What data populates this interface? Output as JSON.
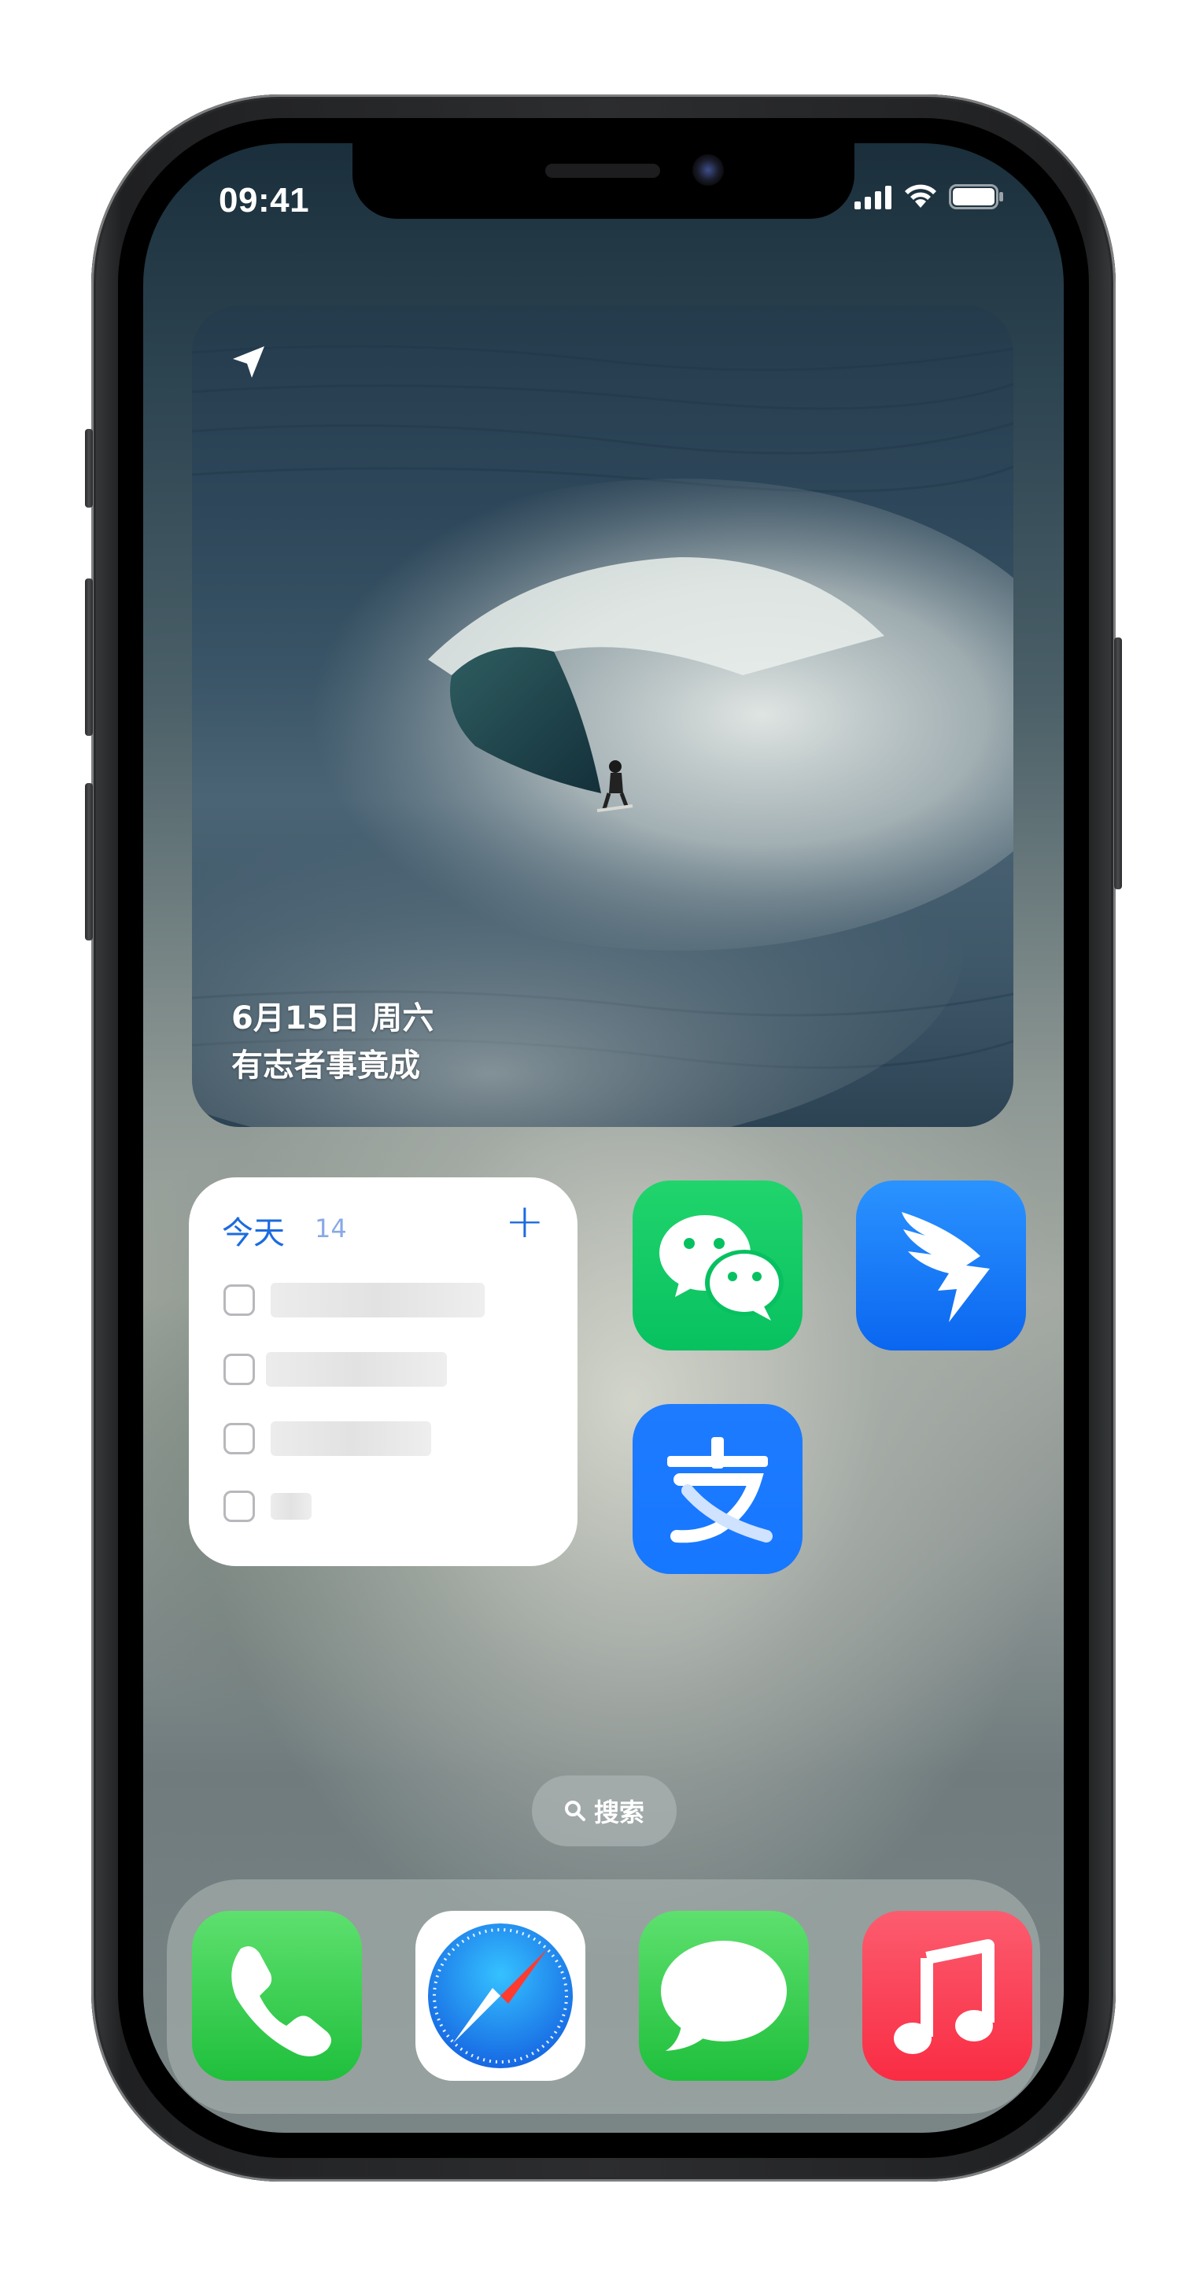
{
  "status_bar": {
    "time": "09:41",
    "icons": [
      "cellular-signal-icon",
      "wifi-icon",
      "battery-icon"
    ]
  },
  "photo_widget": {
    "date_line": "6月15日 周六",
    "quote_line": "有志者事竟成",
    "icon": "location-arrow-icon"
  },
  "reminders_widget": {
    "title": "今天",
    "count": "14",
    "add_icon": "plus-icon",
    "items": [
      {
        "text": ""
      },
      {
        "text": ""
      },
      {
        "text": ""
      },
      {
        "text": ""
      }
    ]
  },
  "home_apps": [
    {
      "name": "WeChat",
      "icon": "wechat-icon",
      "color": "#07c160"
    },
    {
      "name": "DingTalk",
      "icon": "dingtalk-icon",
      "color": "#1677ff"
    },
    {
      "name": "Alipay",
      "icon": "alipay-icon",
      "color": "#1677ff"
    }
  ],
  "search": {
    "label": "搜索",
    "icon": "search-icon"
  },
  "dock_apps": [
    {
      "name": "Phone",
      "icon": "phone-icon",
      "color": "#34c759"
    },
    {
      "name": "Safari",
      "icon": "safari-compass-icon",
      "color": "#1e90ff"
    },
    {
      "name": "Messages",
      "icon": "messages-icon",
      "color": "#34c759"
    },
    {
      "name": "Music",
      "icon": "music-note-icon",
      "color": "#fa2d48"
    }
  ]
}
